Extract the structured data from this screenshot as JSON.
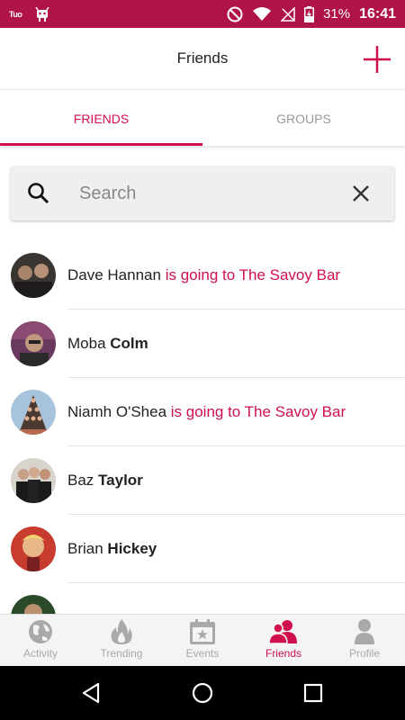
{
  "status_bar": {
    "carrier": "Tuo",
    "battery": "31%",
    "time": "16:41"
  },
  "app_bar": {
    "title": "Friends"
  },
  "tabs": [
    {
      "label": "FRIENDS",
      "active": true
    },
    {
      "label": "GROUPS",
      "active": false
    }
  ],
  "search": {
    "placeholder": "Search"
  },
  "friends": [
    {
      "first": "Dave Hannan",
      "last": "",
      "status": "is going to The Savoy Bar"
    },
    {
      "first": "Moba",
      "last": "Colm",
      "status": ""
    },
    {
      "first": "Niamh O'Shea",
      "last": "",
      "status": "is going to The Savoy Bar"
    },
    {
      "first": "Baz",
      "last": "Taylor",
      "status": ""
    },
    {
      "first": "Brian",
      "last": "Hickey",
      "status": ""
    }
  ],
  "bottom_nav": [
    {
      "label": "Activity",
      "icon": "globe-icon",
      "active": false
    },
    {
      "label": "Trending",
      "icon": "flame-icon",
      "active": false
    },
    {
      "label": "Events",
      "icon": "calendar-icon",
      "active": false
    },
    {
      "label": "Friends",
      "icon": "people-icon",
      "active": true
    },
    {
      "label": "Profile",
      "icon": "person-icon",
      "active": false
    }
  ],
  "colors": {
    "accent": "#d0104c",
    "status_bar": "#b0124a"
  }
}
